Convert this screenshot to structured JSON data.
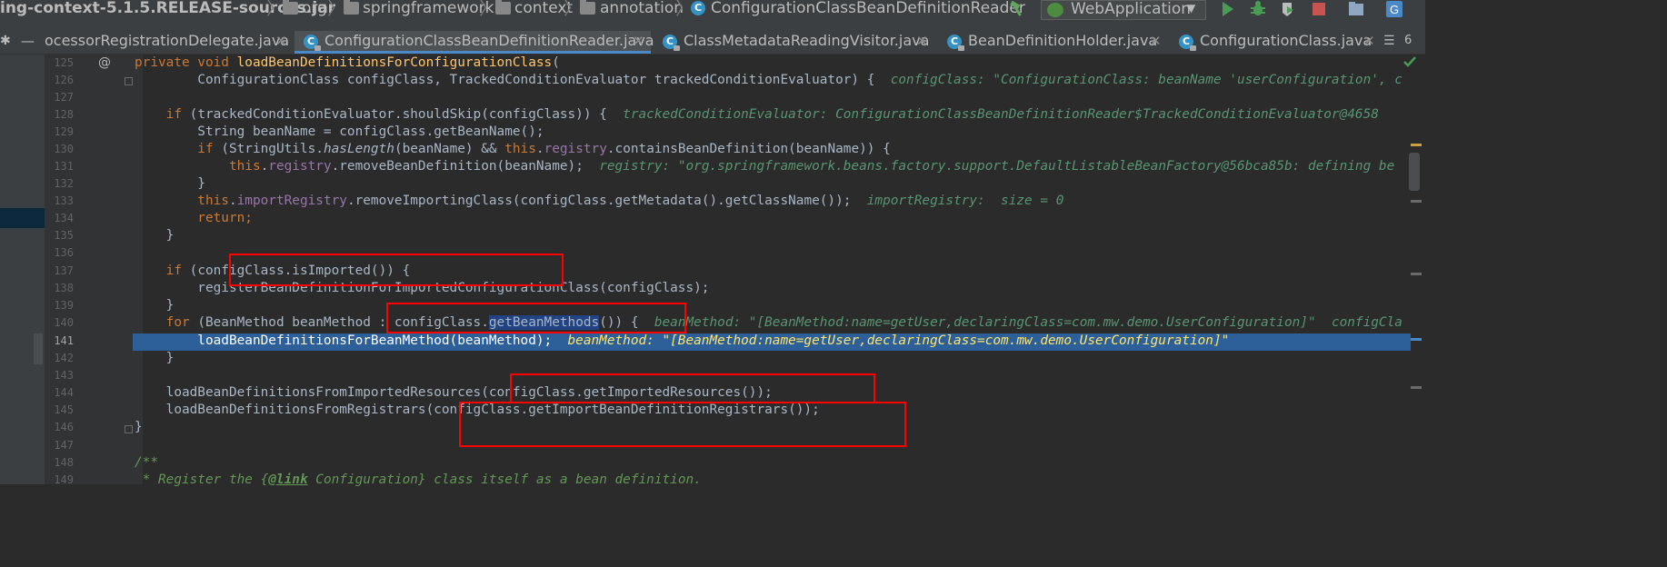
{
  "breadcrumb": {
    "items": [
      "ing-context-5.1.5.RELEASE-sources.jar",
      "org",
      "springframework",
      "context",
      "annotation",
      "ConfigurationClassBeanDefinitionReader"
    ],
    "separator": "〉"
  },
  "toolbar": {
    "run_config_label": "WebApplication",
    "icons": [
      "hammer-icon",
      "run-icon",
      "debug-icon",
      "coverage-icon",
      "stop-icon",
      "project-structure-icon",
      "translate-icon"
    ]
  },
  "tabs": [
    {
      "label": "ocessorRegistrationDelegate.java",
      "active": false
    },
    {
      "label": "ConfigurationClassBeanDefinitionReader.java",
      "active": true
    },
    {
      "label": "ClassMetadataReadingVisitor.java",
      "active": false
    },
    {
      "label": "BeanDefinitionHolder.java",
      "active": false
    },
    {
      "label": "ConfigurationClass.java",
      "active": false
    }
  ],
  "tab_overflow_count": "6",
  "left_strip": {
    "glyph": "✱",
    "dash": "—"
  },
  "gutter_marker": "@",
  "line_numbers": [
    "125",
    "126",
    "127",
    "128",
    "129",
    "130",
    "131",
    "132",
    "133",
    "134",
    "135",
    "136",
    "137",
    "138",
    "139",
    "140",
    "141",
    "142",
    "143",
    "144",
    "145",
    "146",
    "147",
    "148",
    "149"
  ],
  "current_line": "141",
  "code": {
    "l125": {
      "kw": "private void ",
      "fn": "loadBeanDefinitionsForConfigurationClass",
      "rest": "("
    },
    "l126": {
      "text": "        ConfigurationClass configClass, TrackedConditionEvaluator trackedConditionEvaluator) {  ",
      "hint": "configClass: \"ConfigurationClass: beanName 'userConfiguration', c"
    },
    "l128": {
      "kw": "    if ",
      "text": "(trackedConditionEvaluator.shouldSkip(configClass)) {  ",
      "hint": "trackedConditionEvaluator: ConfigurationClassBeanDefinitionReader$TrackedConditionEvaluator@4658"
    },
    "l129": {
      "text": "        String beanName = configClass.getBeanName();"
    },
    "l130": {
      "kw1": "        if ",
      "a": "(StringUtils.",
      "st": "hasLength",
      "b": "(beanName) && ",
      "kw2": "this",
      "c": ".",
      "fld": "registry",
      "d": ".containsBeanDefinition(beanName)) {"
    },
    "l131": {
      "kw": "            this",
      "a": ".",
      "fld": "registry",
      "b": ".removeBeanDefinition(beanName);  ",
      "hint": "registry: \"org.springframework.beans.factory.support.DefaultListableBeanFactory@56bca85b: defining be"
    },
    "l132": {
      "text": "        }"
    },
    "l133": {
      "kw": "        this",
      "a": ".",
      "fld": "importRegistry",
      "b": ".removeImportingClass(configClass.getMetadata().getClassName());  ",
      "hint": "importRegistry:  size = 0"
    },
    "l134": {
      "kw": "        return",
      "a": ";"
    },
    "l135": {
      "text": "    }"
    },
    "l137": {
      "kw": "    if ",
      "text": "(configClass.isImported()) {"
    },
    "l138": {
      "text": "        registerBeanDefinitionForImportedConfigurationClass(configClass);"
    },
    "l139": {
      "text": "    }"
    },
    "l140": {
      "kw": "    for ",
      "a": "(BeanMethod beanMethod : configClass.",
      "sel": "getBeanMethods",
      "b": "()) {  ",
      "hint": "beanMethod: \"[BeanMethod:name=getUser,declaringClass=com.mw.demo.UserConfiguration]\"  configCla"
    },
    "l141": {
      "text": "        loadBeanDefinitionsForBeanMethod(beanMethod);  ",
      "hint": "beanMethod: \"[BeanMethod:name=getUser,declaringClass=com.mw.demo.UserConfiguration]\""
    },
    "l142": {
      "text": "    }"
    },
    "l144": {
      "text": "    loadBeanDefinitionsFromImportedResources(configClass.getImportedResources());"
    },
    "l145": {
      "text": "    loadBeanDefinitionsFromRegistrars(configClass.getImportBeanDefinitionRegistrars());"
    },
    "l146": {
      "text": "}"
    },
    "l148": {
      "text": "/**"
    },
    "l149": {
      "a": " * Register the {",
      "tag": "@link",
      "b": " Configuration} class itself as a bean definition."
    }
  },
  "colors": {
    "annotation_box": "#ff0000",
    "execution_line": "#2d6099",
    "selection": "#214283",
    "keyword": "#cc7832",
    "method_decl": "#ffc66d",
    "field": "#9876aa",
    "debug_hint": "#589572"
  }
}
